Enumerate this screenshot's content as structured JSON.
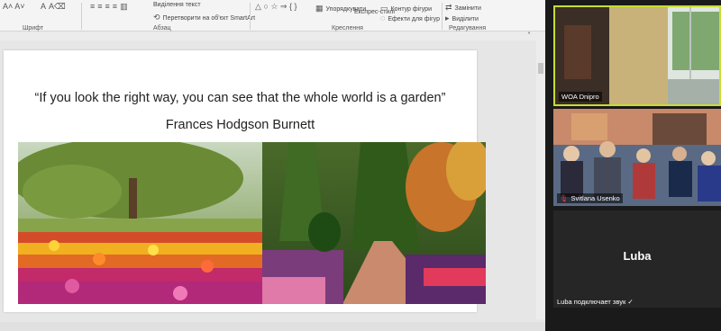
{
  "ribbon": {
    "item_highlight_text": "Виділення текст",
    "item_smartart": "Перетворити на об'єкт SmartArt",
    "item_arrange": "Упорядкувати",
    "item_quick_styles": "Експрес-стилі",
    "item_shape_outline": "Контур фігури",
    "item_shape_effects": "Ефекти для фігур",
    "item_replace": "Замінити",
    "item_select": "Виділити",
    "group_font": "Шрифт",
    "group_paragraph": "Абзац",
    "group_drawing": "Креслення",
    "group_editing": "Редагування"
  },
  "slide": {
    "quote": "“If you look the right way, you can see that the whole world is a garden”",
    "author": "Frances Hodgson Burnett"
  },
  "participants": {
    "p1_name": "WOA Dnipro",
    "p2_name": "Svitlana Usenko",
    "p3_name": "Luba",
    "p3_status": "Luba подключает звук"
  }
}
